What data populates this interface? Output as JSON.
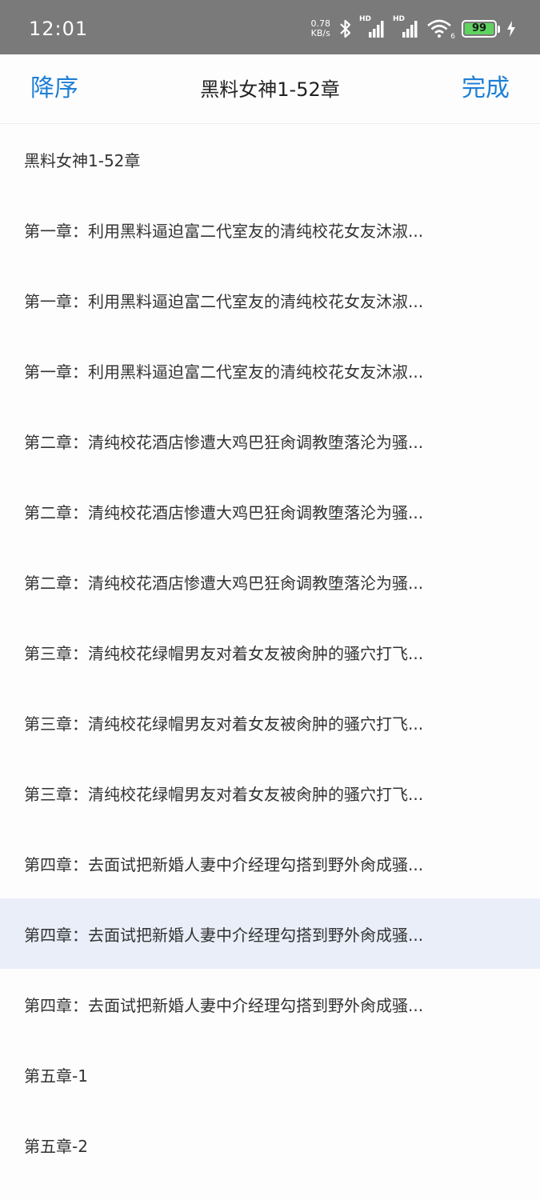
{
  "status_bar": {
    "time": "12:01",
    "net_speed_value": "0.78",
    "net_speed_unit": "KB/s",
    "signal_label_1": "HD",
    "signal_label_2": "HD",
    "wifi_label": "6",
    "battery_level": "99",
    "icons": [
      "bluetooth-icon",
      "signal-icon",
      "signal-icon",
      "wifi-icon",
      "battery-icon",
      "charging-icon"
    ]
  },
  "header": {
    "left_button": "降序",
    "title": "黑料女神1-52章",
    "right_button": "完成",
    "accent_color": "#1e7fd6"
  },
  "chapters": [
    {
      "label": "黑料女神1-52章"
    },
    {
      "label": "第一章：利用黑料逼迫富二代室友的清纯校花女友沐淑..."
    },
    {
      "label": "第一章：利用黑料逼迫富二代室友的清纯校花女友沐淑..."
    },
    {
      "label": "第一章：利用黑料逼迫富二代室友的清纯校花女友沐淑..."
    },
    {
      "label": "第二章：清纯校花酒店惨遭大鸡巴狂肏调教堕落沦为骚..."
    },
    {
      "label": "第二章：清纯校花酒店惨遭大鸡巴狂肏调教堕落沦为骚..."
    },
    {
      "label": "第二章：清纯校花酒店惨遭大鸡巴狂肏调教堕落沦为骚..."
    },
    {
      "label": "第三章：清纯校花绿帽男友对着女友被肏肿的骚穴打飞..."
    },
    {
      "label": "第三章：清纯校花绿帽男友对着女友被肏肿的骚穴打飞..."
    },
    {
      "label": "第三章：清纯校花绿帽男友对着女友被肏肿的骚穴打飞..."
    },
    {
      "label": "第四章：去面试把新婚人妻中介经理勾搭到野外肏成骚..."
    },
    {
      "label": "第四章：去面试把新婚人妻中介经理勾搭到野外肏成骚...",
      "active": true
    },
    {
      "label": "第四章：去面试把新婚人妻中介经理勾搭到野外肏成骚..."
    },
    {
      "label": "第五章-1"
    },
    {
      "label": "第五章-2"
    }
  ],
  "colors": {
    "status_bar_bg": "#7a7a7a",
    "active_row_bg": "#e9eef8",
    "battery_fill": "#5fd35f"
  }
}
